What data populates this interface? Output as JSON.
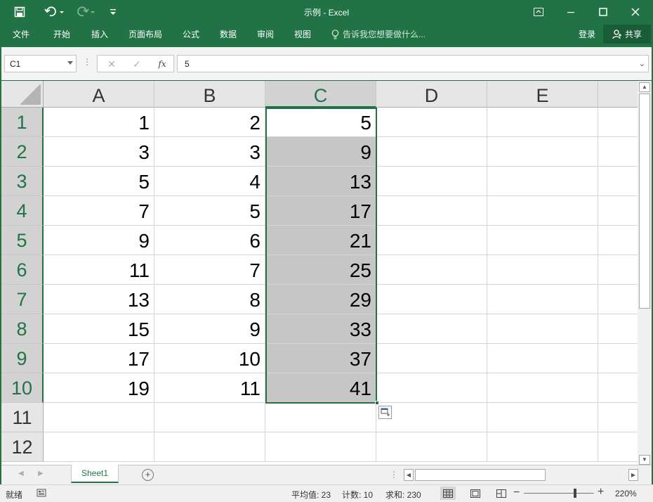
{
  "titlebar": {
    "title": "示例 - Excel",
    "save_icon": "save-icon",
    "undo_icon": "undo-icon",
    "redo_icon": "redo-icon",
    "customize_icon": "customize-qat-icon"
  },
  "ribbon": {
    "tabs": [
      "文件",
      "开始",
      "插入",
      "页面布局",
      "公式",
      "数据",
      "审阅",
      "视图"
    ],
    "tell_me": "告诉我您想要做什么...",
    "sign_in": "登录",
    "share": "共享"
  },
  "formula_bar": {
    "name_box": "C1",
    "content": "5",
    "fx_label": "fx"
  },
  "grid": {
    "columns": [
      "A",
      "B",
      "C",
      "D",
      "E"
    ],
    "rows": [
      "1",
      "2",
      "3",
      "4",
      "5",
      "6",
      "7",
      "8",
      "9",
      "10",
      "11",
      "12"
    ],
    "selected_column": "C",
    "selection": "C1:C10",
    "active_cell": "C1",
    "cells": {
      "A": [
        "1",
        "3",
        "5",
        "7",
        "9",
        "11",
        "13",
        "15",
        "17",
        "19",
        "",
        ""
      ],
      "B": [
        "2",
        "3",
        "4",
        "5",
        "6",
        "7",
        "8",
        "9",
        "10",
        "11",
        "",
        ""
      ],
      "C": [
        "5",
        "9",
        "13",
        "17",
        "21",
        "25",
        "29",
        "33",
        "37",
        "41",
        "",
        ""
      ],
      "D": [
        "",
        "",
        "",
        "",
        "",
        "",
        "",
        "",
        "",
        "",
        "",
        ""
      ],
      "E": [
        "",
        "",
        "",
        "",
        "",
        "",
        "",
        "",
        "",
        "",
        "",
        ""
      ]
    }
  },
  "sheets": {
    "tabs": [
      "Sheet1"
    ],
    "active": "Sheet1"
  },
  "status": {
    "ready": "就绪",
    "average": "平均值: 23",
    "count": "计数: 10",
    "sum": "求和: 230",
    "zoom": "220%",
    "zoom_level_fraction": 0.73
  },
  "colors": {
    "accent": "#217346",
    "selection_fill": "#c6c6c6"
  }
}
